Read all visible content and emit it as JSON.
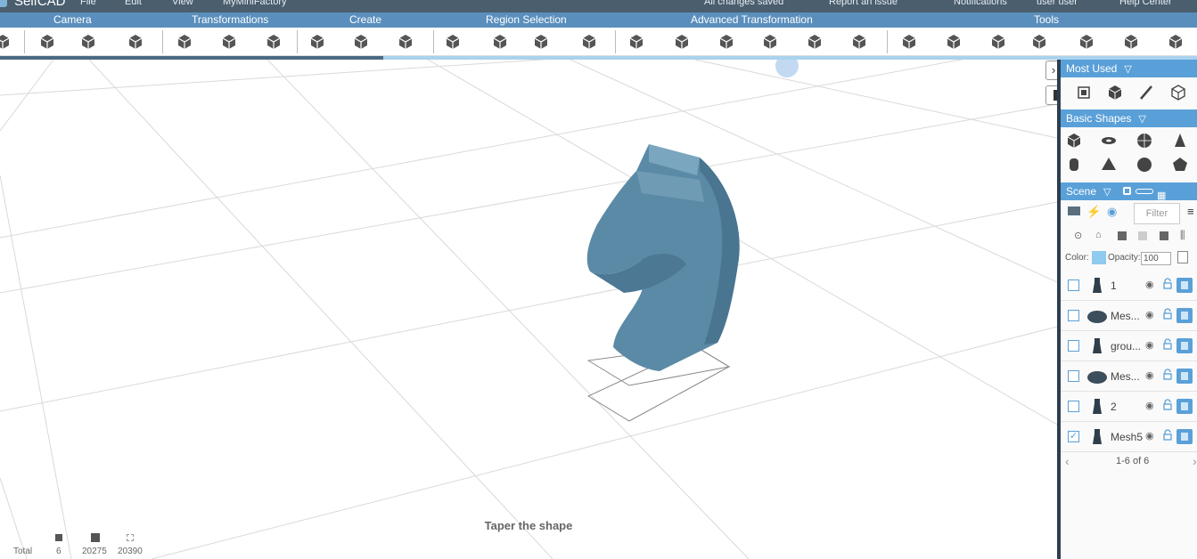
{
  "menubar": {
    "logo": "SelfCAD",
    "file": "File",
    "edit": "Edit",
    "view": "View",
    "project": "MyMiniFactory",
    "status": "All changes saved",
    "report": "Report an issue",
    "notifications": "Notifications",
    "user": "user user",
    "help": "Help Center"
  },
  "groups": {
    "camera": "Camera",
    "transformations": "Transformations",
    "create": "Create",
    "region_selection": "Region Selection",
    "advanced_transformation": "Advanced Transformation",
    "tools": "Tools"
  },
  "progress": {
    "fraction": 0.32
  },
  "viewport": {
    "hint": "Taper the shape",
    "stats": {
      "total_label": "Total",
      "objects": "6",
      "faces": "20275",
      "vertices": "20390"
    }
  },
  "panel": {
    "most_used": "Most Used",
    "basic_shapes": "Basic Shapes",
    "scene": "Scene",
    "filter_placeholder": "Filter",
    "color_label": "Color:",
    "opacity_label": "Opacity:",
    "opacity_value": "100",
    "rows": [
      {
        "name": "1",
        "checked": false
      },
      {
        "name": "Mes...",
        "checked": false
      },
      {
        "name": "grou...",
        "checked": false
      },
      {
        "name": "Mes...",
        "checked": false
      },
      {
        "name": "2",
        "checked": false
      },
      {
        "name": "Mesh5",
        "checked": true
      }
    ],
    "pager": "1-6 of 6",
    "prev": "‹",
    "next": "›"
  },
  "colors": {
    "accent": "#5aa0d8",
    "menubar": "#4a5e6e",
    "model": "#5b8aa6"
  }
}
